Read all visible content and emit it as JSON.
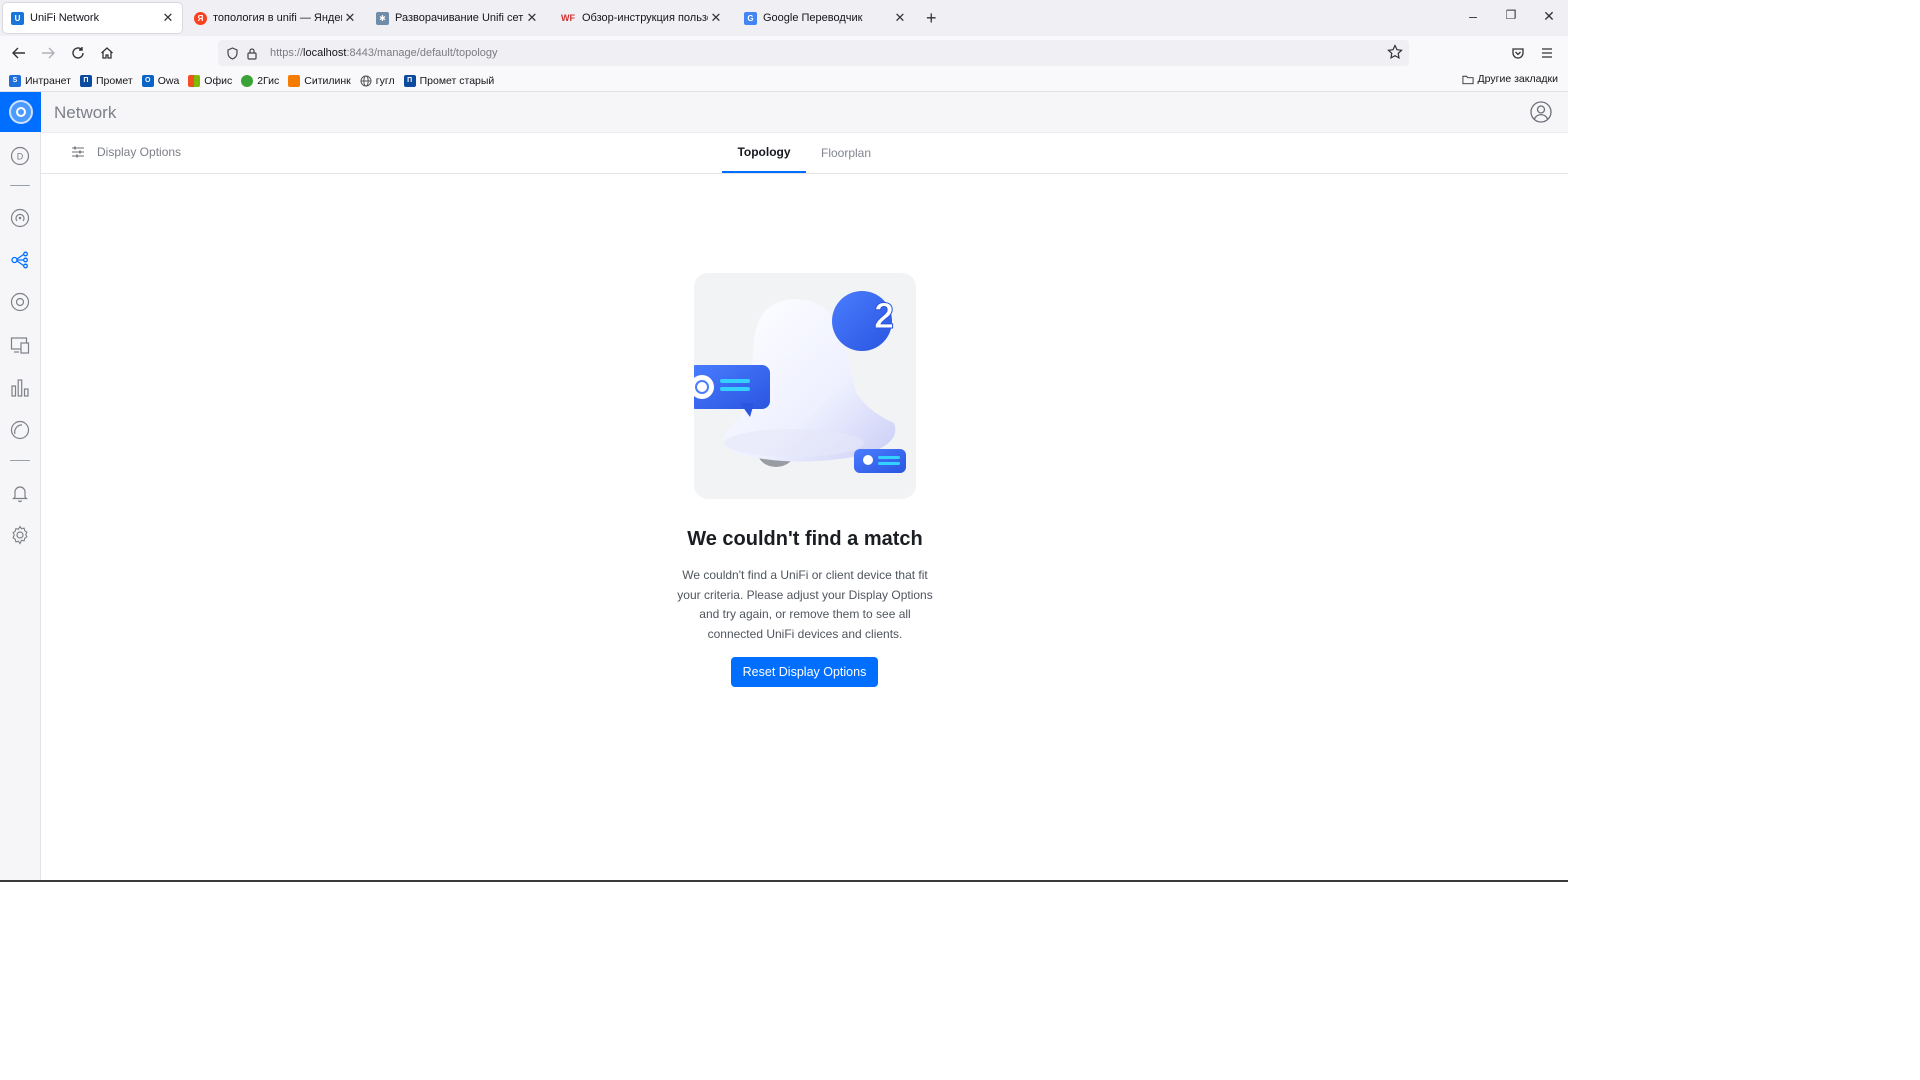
{
  "browser": {
    "tabs": [
      {
        "title": "UniFi Network",
        "icon": "unifi-favicon",
        "active": true
      },
      {
        "title": "топология в unifi — Яндекс: на",
        "icon": "yandex-favicon",
        "active": false
      },
      {
        "title": "Разворачивание Unifi сети. Ли",
        "icon": "habr-favicon",
        "active": false
      },
      {
        "title": "Обзор-инструкция пользовате",
        "icon": "wf-favicon",
        "active": false
      },
      {
        "title": "Google Переводчик",
        "icon": "google-translate-favicon",
        "active": false
      }
    ],
    "url": {
      "scheme": "https://",
      "host": "localhost",
      "rest": ":8443/manage/default/topology"
    },
    "bookmarks": [
      {
        "label": "Интранет",
        "color": "#1e6fd9",
        "glyph": "S"
      },
      {
        "label": "Промет",
        "color": "#0b4a9c",
        "glyph": "П"
      },
      {
        "label": "Owa",
        "color": "#0a64c8",
        "glyph": "O"
      },
      {
        "label": "Офис",
        "color": "#e64a19",
        "glyph": ""
      },
      {
        "label": "2Гис",
        "color": "#3aa335",
        "glyph": ""
      },
      {
        "label": "Ситилинк",
        "color": "#f57c00",
        "glyph": ""
      },
      {
        "label": "гугл",
        "color": "#555555",
        "glyph": ""
      },
      {
        "label": "Промет старый",
        "color": "#0b4a9c",
        "glyph": "П"
      }
    ],
    "other_bookmarks": "Другие закладки"
  },
  "app": {
    "title": "Network",
    "accent_color": "#006fff",
    "sidebar_icons": [
      "dashboard-icon",
      "devices-icon",
      "topology-icon",
      "clients-icon",
      "insights-icon",
      "statistics-icon",
      "system-log-icon",
      "alerts-icon",
      "settings-icon"
    ],
    "toolbar": {
      "display_options": "Display Options",
      "tabs": [
        {
          "label": "Topology",
          "active": true
        },
        {
          "label": "Floorplan",
          "active": false
        }
      ]
    },
    "empty_state": {
      "heading": "We couldn't find a match",
      "description": "We couldn't find a UniFi or client device that fit your criteria. Please adjust your Display Options and try again, or remove them to see all connected UniFi devices and clients.",
      "button": "Reset Display Options",
      "badge_number": "2"
    }
  }
}
